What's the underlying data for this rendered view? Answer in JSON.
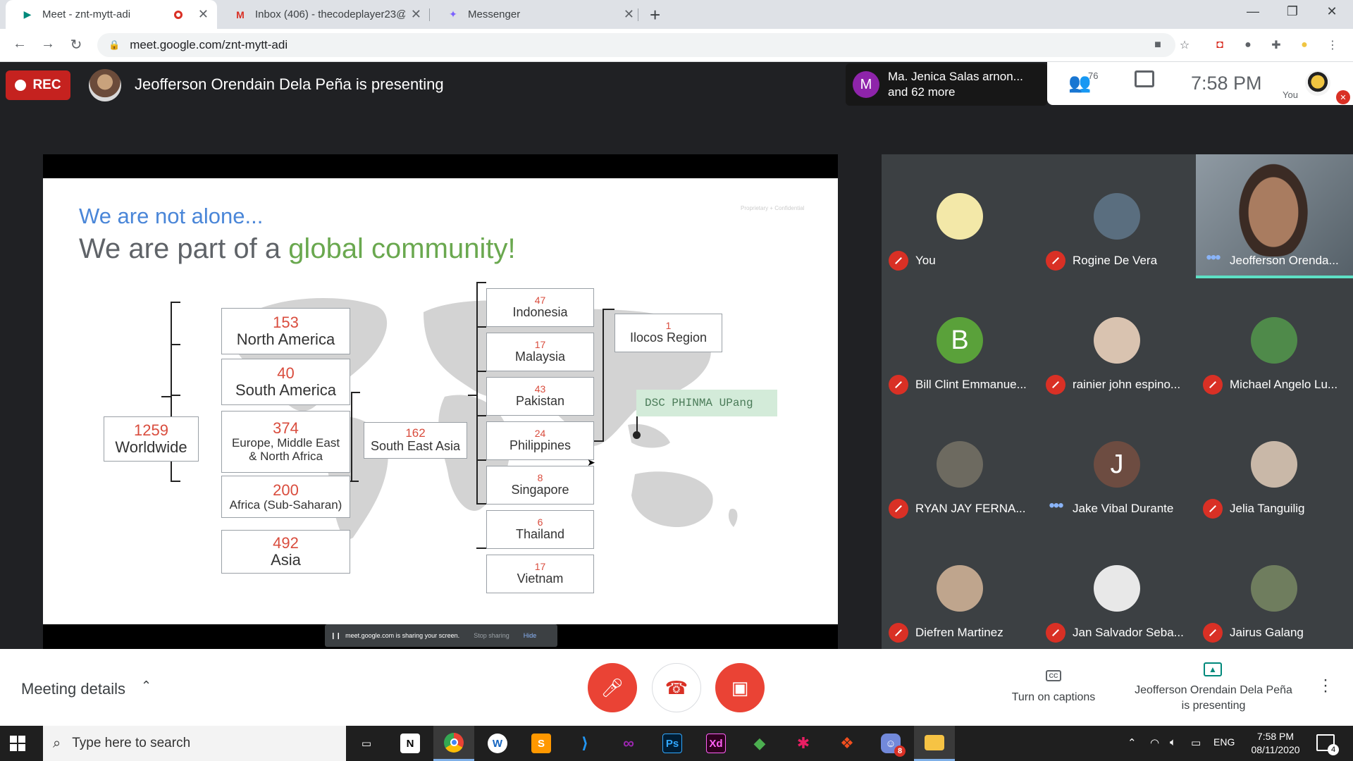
{
  "browser": {
    "tabs": [
      {
        "title": "Meet - znt-mytt-adi",
        "favicon": "google-meet-icon"
      },
      {
        "title": "Inbox (406) - thecodeplayer23@g",
        "favicon": "gmail-icon"
      },
      {
        "title": "Messenger",
        "favicon": "messenger-icon"
      }
    ],
    "url": "meet.google.com/znt-mytt-adi"
  },
  "meet": {
    "rec_label": "REC",
    "presenting_title": "Jeofferson Orendain Dela Peña is presenting",
    "joined": {
      "initial": "M",
      "line1": "Ma. Jenica Salas arnon...",
      "line2": "and 62 more"
    },
    "people_count": "76",
    "clock": "7:58 PM",
    "you_label": "You"
  },
  "slide": {
    "heading": "We are not alone...",
    "subheading_prefix": "We are part of a ",
    "subheading_highlight": "global community!",
    "confidential": "Proprietary + Confidential",
    "worldwide": {
      "num": "1259",
      "label": "Worldwide"
    },
    "regions": [
      {
        "num": "153",
        "label": "North America"
      },
      {
        "num": "40",
        "label": "South America"
      },
      {
        "num": "374",
        "label": "Europe, Middle East & North Africa"
      },
      {
        "num": "200",
        "label": "Africa (Sub-Saharan)"
      },
      {
        "num": "492",
        "label": "Asia"
      }
    ],
    "sea": {
      "num": "162",
      "label": "South East Asia"
    },
    "countries": [
      {
        "num": "47",
        "label": "Indonesia"
      },
      {
        "num": "17",
        "label": "Malaysia"
      },
      {
        "num": "43",
        "label": "Pakistan"
      },
      {
        "num": "24",
        "label": "Philippines"
      },
      {
        "num": "8",
        "label": "Singapore"
      },
      {
        "num": "6",
        "label": "Thailand"
      },
      {
        "num": "17",
        "label": "Vietnam"
      }
    ],
    "ilocos": {
      "num": "1",
      "label": "Ilocos Region"
    },
    "dsc_label": "DSC PHINMA UPang"
  },
  "share_bar": {
    "text": "meet.google.com is sharing your screen.",
    "stop": "Stop sharing",
    "hide": "Hide"
  },
  "participants": [
    {
      "name": "You",
      "initial": "",
      "color": "#f3e8a8",
      "status": "muted"
    },
    {
      "name": "Rogine De Vera",
      "initial": "",
      "color": "#5a6e7f",
      "status": "muted"
    },
    {
      "name": "Jeofferson Orenda...",
      "initial": "",
      "color": "",
      "status": "speaking"
    },
    {
      "name": "Bill Clint Emmanue...",
      "initial": "B",
      "color": "#5aa13a",
      "status": "muted"
    },
    {
      "name": "rainier john espino...",
      "initial": "",
      "color": "#d9c3b0",
      "status": "muted"
    },
    {
      "name": "Michael Angelo Lu...",
      "initial": "",
      "color": "#4f8a4a",
      "status": "muted"
    },
    {
      "name": "RYAN JAY FERNA...",
      "initial": "",
      "color": "#6d6a60",
      "status": "muted"
    },
    {
      "name": "Jake Vibal Durante",
      "initial": "J",
      "color": "#6d4c41",
      "status": "active"
    },
    {
      "name": "Jelia Tanguilig",
      "initial": "",
      "color": "#c9b8a8",
      "status": "muted"
    },
    {
      "name": "Diefren Martinez",
      "initial": "",
      "color": "#bfa58d",
      "status": "muted"
    },
    {
      "name": "Jan Salvador Seba...",
      "initial": "",
      "color": "#e8e8e8",
      "status": "muted"
    },
    {
      "name": "Jairus Galang",
      "initial": "",
      "color": "#6f7d5e",
      "status": "muted"
    }
  ],
  "bottom": {
    "meeting_details": "Meeting details",
    "captions": "Turn on captions",
    "presenting_line1": "Jeofferson Orendain Dela Peña",
    "presenting_line2": "is presenting"
  },
  "taskbar": {
    "search_placeholder": "Type here to search",
    "lang": "ENG",
    "time": "7:58 PM",
    "date": "08/11/2020",
    "notifications": "4",
    "apps": [
      "task-view",
      "notion",
      "chrome",
      "app-w",
      "sublime",
      "vscode",
      "visual-studio",
      "photoshop",
      "adobe-xd",
      "app-diamond",
      "slack",
      "figma",
      "discord",
      "file-explorer"
    ],
    "app_badge": "8"
  }
}
